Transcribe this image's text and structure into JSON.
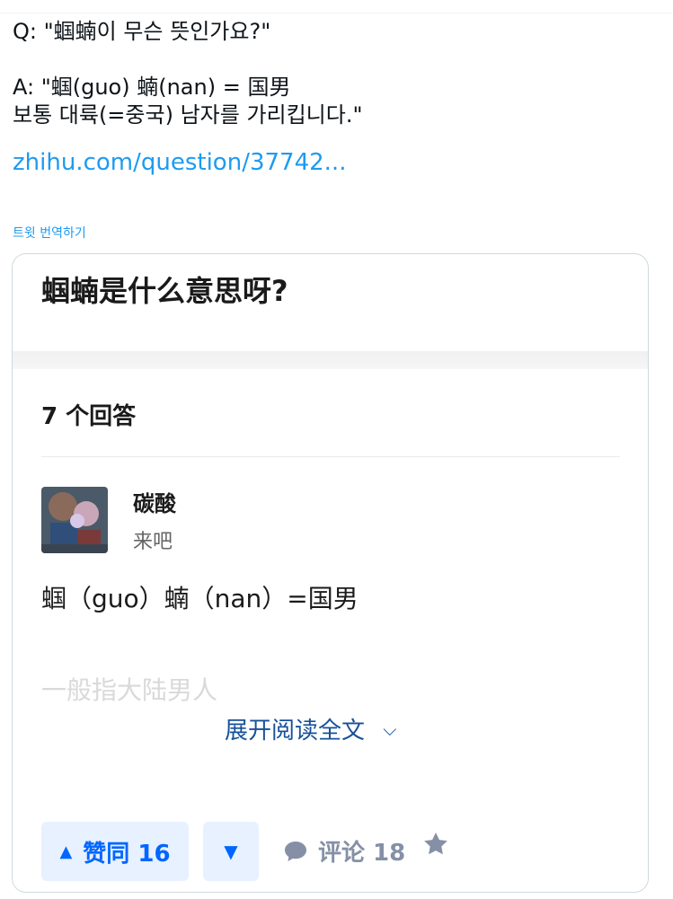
{
  "tweet": {
    "question": "Q: \"蝈蝻이 무슨 뜻인가요?\"",
    "answer_line1": "A: \"蝈(guo) 蝻(nan) = 国男",
    "answer_line2": "보통 대륙(=중국) 남자를 가리킵니다.\"",
    "link": "zhihu.com/question/37742...",
    "translate": "트윗 번역하기"
  },
  "card": {
    "title": "蝈蝻是什么意思呀?",
    "answers_count": "7 个回答",
    "author_name": "碳酸",
    "author_bio": "来吧",
    "answer_text": "蝈（guo）蝻（nan）=国男",
    "answer_faded": "一般指大陆男人",
    "expand_label": "展开阅读全文",
    "vote_up_label": "赞同 16",
    "comment_label": "评论 18"
  },
  "icons": {
    "vote_up": "triangle-up-icon",
    "vote_down": "triangle-down-icon",
    "comment": "comment-bubble-icon",
    "star": "star-icon",
    "chevron": "chevron-down-icon"
  },
  "colors": {
    "link": "#1d9bf0",
    "zhihu_blue": "#0066ff",
    "zhihu_link": "#175199",
    "muted": "#8590a6"
  }
}
